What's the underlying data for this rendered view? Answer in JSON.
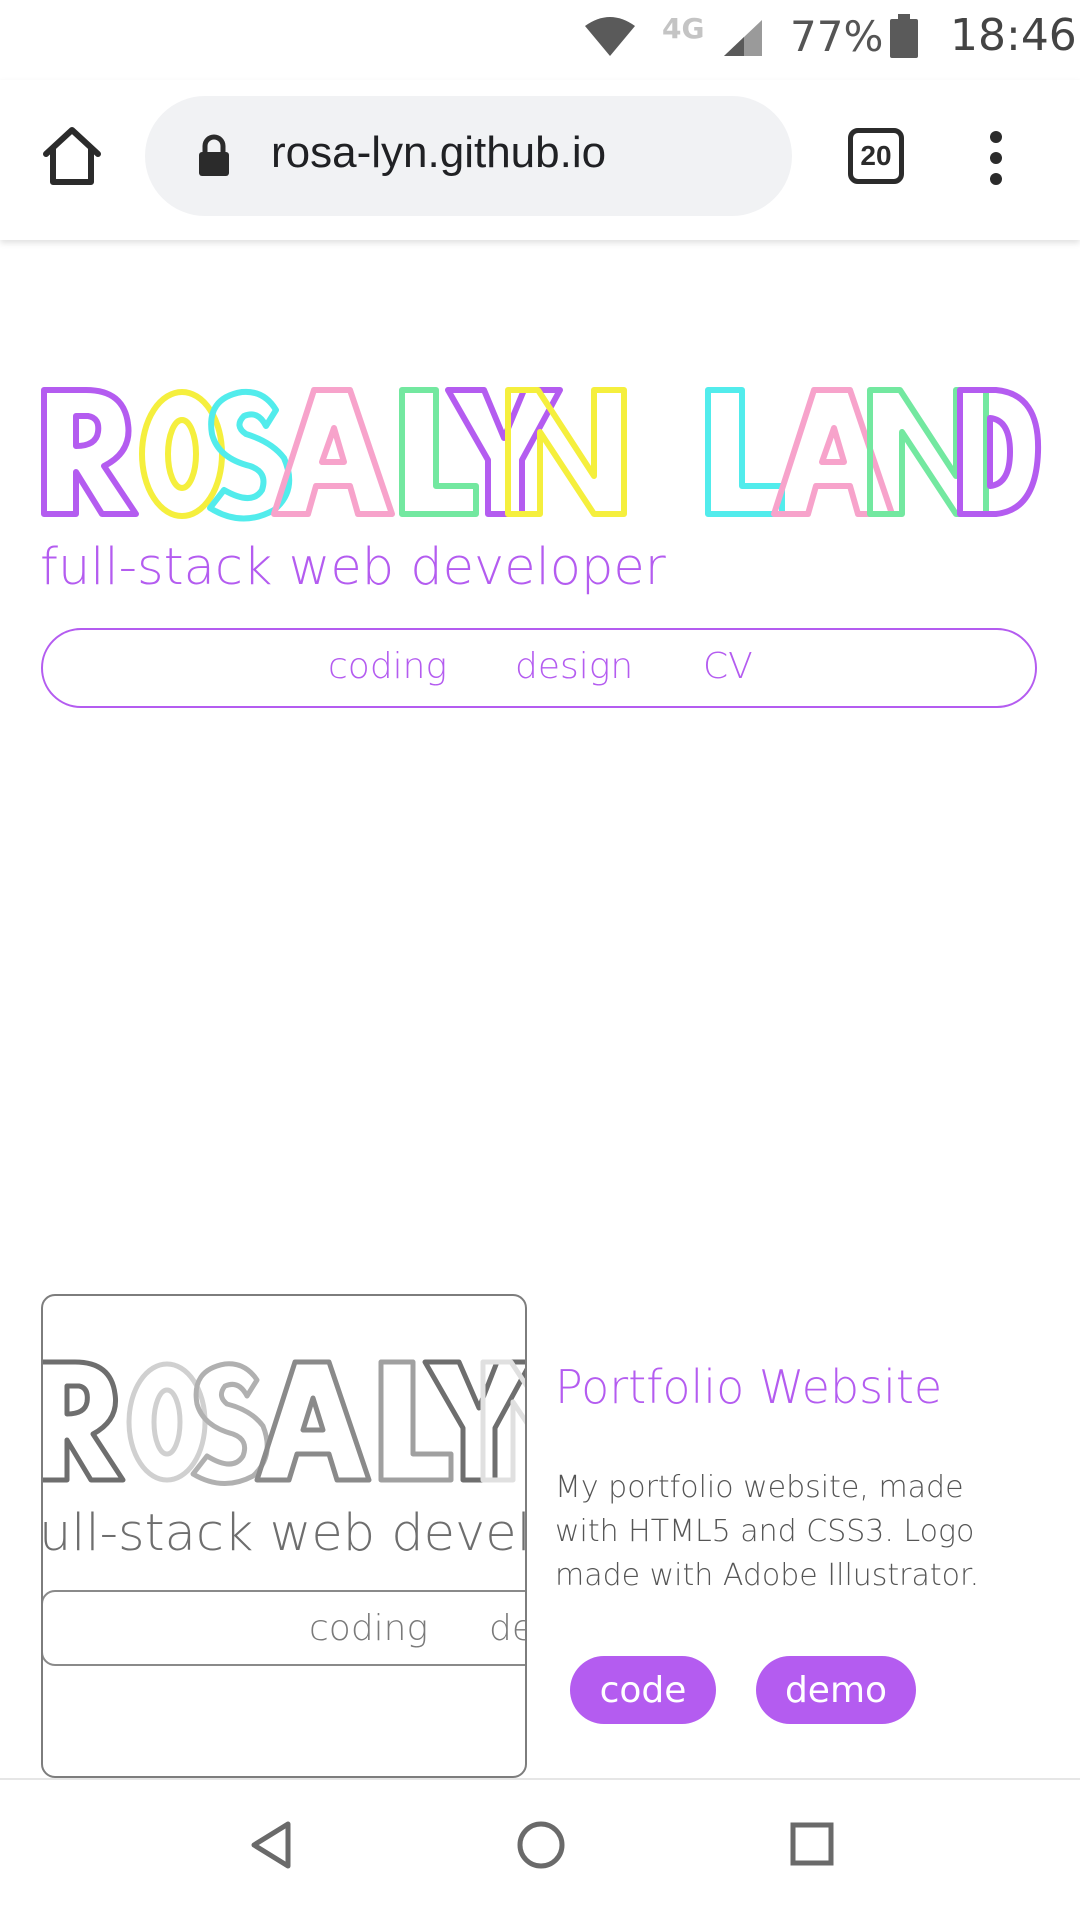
{
  "status_bar": {
    "network": "4G",
    "battery_percent": "77%",
    "time": "18:46",
    "icons": [
      "wifi-icon",
      "cell-signal-icon",
      "battery-icon"
    ]
  },
  "browser": {
    "url": "rosa-lyn.github.io",
    "tab_count": "20",
    "icons": [
      "home-icon",
      "lock-icon",
      "tabs-icon",
      "more-vert-icon"
    ]
  },
  "hero": {
    "logo_text": "ROSALYN LAND",
    "tagline": "full-stack web developer",
    "nav": [
      "coding",
      "design",
      "CV"
    ],
    "colors": {
      "accent": "#b45cf0",
      "logo_purple": "#b45cf0",
      "logo_yellow": "#f5ef3d",
      "logo_cyan": "#52ecec",
      "logo_pink": "#f7a3cb",
      "logo_green": "#73e8a0"
    }
  },
  "project": {
    "title": "Portfolio Website",
    "description": "My portfolio website, made with HTML5 and CSS3. Logo made with Adobe Illustrator.",
    "buttons": {
      "code": "code",
      "demo": "demo"
    },
    "thumbnail": {
      "logo_text": "ROSALYN",
      "tagline": "full-stack web developer",
      "nav": [
        "coding",
        "design"
      ]
    }
  },
  "android_nav": {
    "icons": [
      "back-icon",
      "home-circle-icon",
      "recents-icon"
    ]
  }
}
